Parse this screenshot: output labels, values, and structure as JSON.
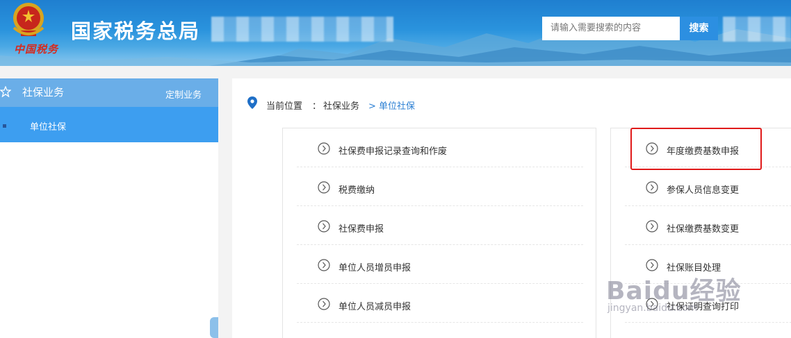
{
  "header": {
    "site_title": "国家税务总局",
    "logo_script": "中国税务",
    "search_placeholder": "请输入需要搜索的内容",
    "search_button": "搜索"
  },
  "sidebar": {
    "title": "社保业务",
    "custom_link": "定制业务",
    "items": [
      {
        "label": "单位社保"
      }
    ]
  },
  "breadcrumb": {
    "label": "当前位置",
    "separator": "：",
    "level1": "社保业务",
    "level2": "> 单位社保"
  },
  "left_menu": [
    {
      "label": "社保费申报记录查询和作废"
    },
    {
      "label": "税费缴纳"
    },
    {
      "label": "社保费申报"
    },
    {
      "label": "单位人员增员申报"
    },
    {
      "label": "单位人员减员申报"
    }
  ],
  "right_menu": [
    {
      "label": "年度缴费基数申报"
    },
    {
      "label": "参保人员信息变更"
    },
    {
      "label": "社保缴费基数变更"
    },
    {
      "label": "社保账目处理"
    },
    {
      "label": "社保证明查询打印"
    }
  ],
  "watermark": {
    "big": "Baidu经验",
    "small": "jingyan.baidu.com"
  },
  "colors": {
    "header_blue": "#2a93dd",
    "sidebar_active": "#3d9ef0",
    "sidebar_head": "#6aaee8",
    "highlight_red": "#e01a1a",
    "link_blue": "#2b7fd3"
  }
}
